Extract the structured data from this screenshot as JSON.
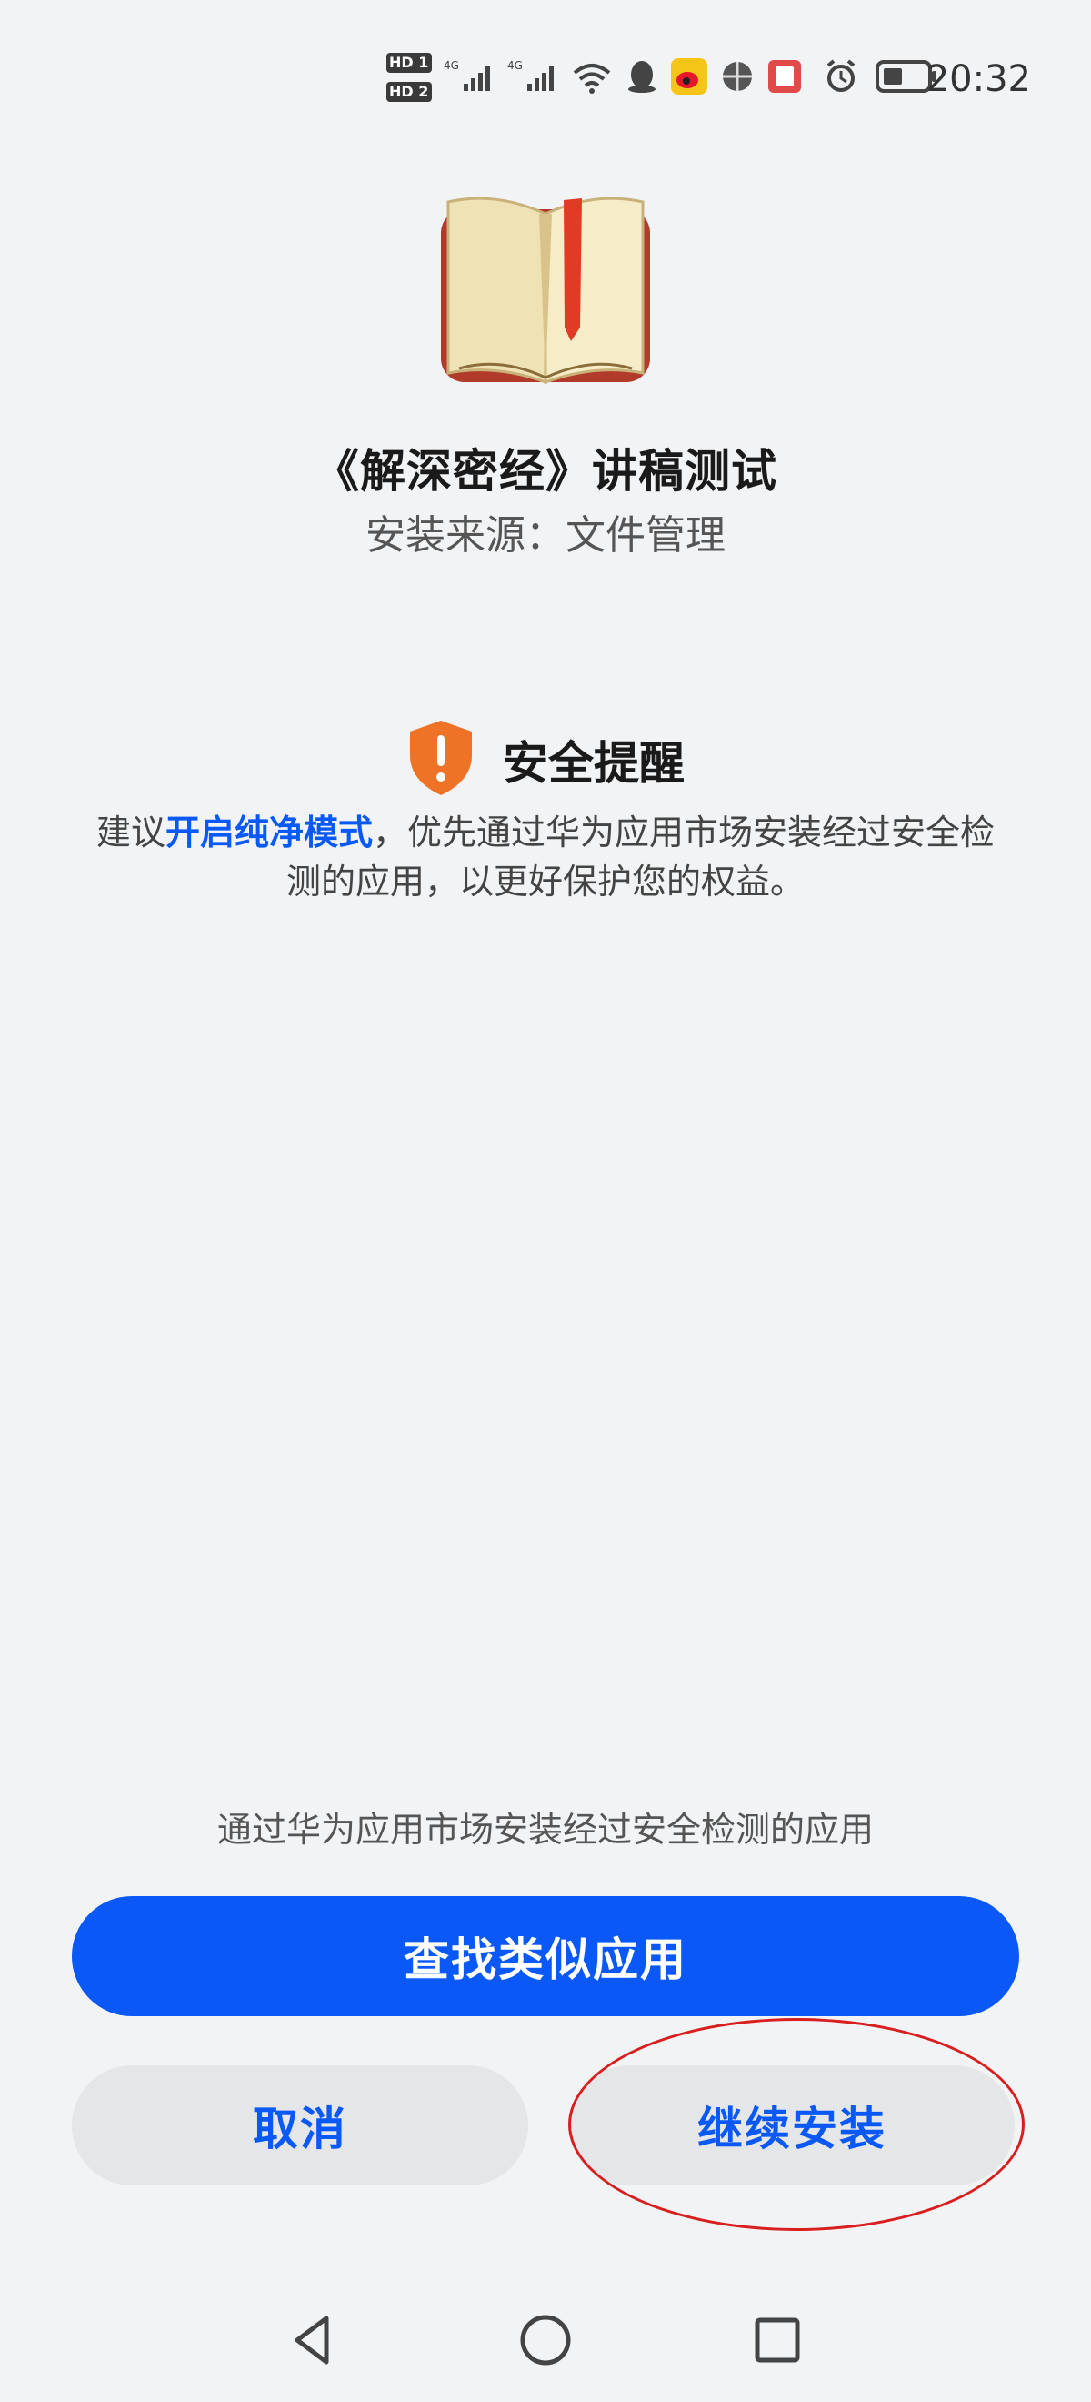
{
  "status_bar": {
    "hd1": "HD 1",
    "hd2": "HD 2",
    "net1": "4G",
    "net2": "4G",
    "time": "20:32"
  },
  "app": {
    "name": "《解深密经》讲稿测试",
    "source": "安装来源：文件管理"
  },
  "security": {
    "title": "安全提醒",
    "text_prefix": "建议",
    "link_text": "开启纯净模式",
    "text_suffix": "，优先通过华为应用市场安装经过安全检测的应用，以更好保护您的权益。"
  },
  "actions": {
    "recommend_text": "通过华为应用市场安装经过安全检测的应用",
    "find_similar": "查找类似应用",
    "cancel": "取消",
    "continue_install": "继续安装"
  },
  "colors": {
    "accent": "#0a59f7",
    "warning": "#ee7326",
    "annotation": "#d81e1e"
  }
}
